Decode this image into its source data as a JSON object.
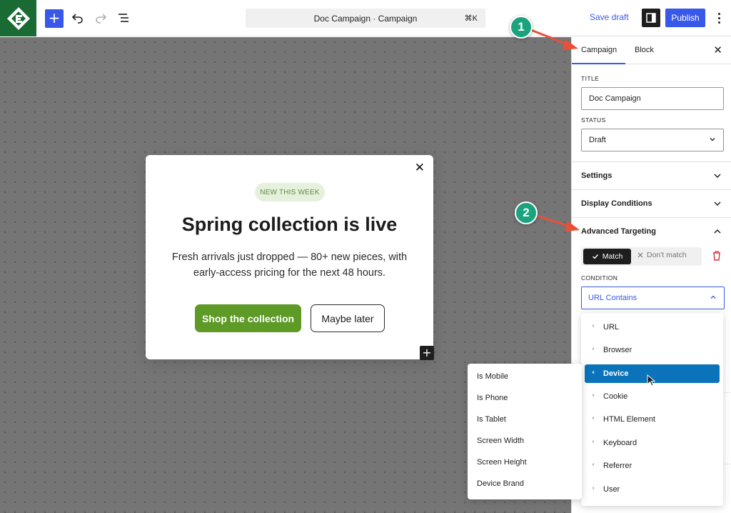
{
  "topbar": {
    "add_label": "+",
    "command_title": "Doc Campaign · Campaign",
    "command_shortcut": "⌘K",
    "save_draft_label": "Save draft",
    "publish_label": "Publish"
  },
  "popup": {
    "badge": "NEW THIS WEEK",
    "title": "Spring collection is live",
    "body": "Fresh arrivals just dropped — 80+ new pieces, with early-access pricing for the next 48 hours.",
    "primary_button": "Shop the collection",
    "secondary_button": "Maybe later",
    "close_label": "✕",
    "add_block_label": "+",
    "colors": {
      "primary": "#5d9a26",
      "badge_bg": "#e5f1dd"
    }
  },
  "sidebar": {
    "tabs": [
      "Campaign",
      "Block"
    ],
    "active_tab": "Campaign",
    "close_label": "✕",
    "title_label": "TITLE",
    "title_value": "Doc Campaign",
    "status_label": "STATUS",
    "status_value": "Draft",
    "panels": [
      "Settings",
      "Display Conditions",
      "Advanced Targeting"
    ],
    "match_label": "Match",
    "dont_match_label": "Don't match",
    "condition_label": "CONDITION",
    "condition_value": "URL Contains"
  },
  "dropdown": {
    "items": [
      "URL",
      "Browser",
      "Device",
      "Cookie",
      "HTML Element",
      "Keyboard",
      "Referrer",
      "User"
    ],
    "active": "Device"
  },
  "submenu": {
    "items": [
      "Is Mobile",
      "Is Phone",
      "Is Tablet",
      "Screen Width",
      "Screen Height",
      "Device Brand"
    ]
  },
  "callouts": [
    "1",
    "2"
  ],
  "colors": {
    "accent": "#3858e9",
    "logo_bg": "#1a6b33",
    "callout": "#1ba37e",
    "arrow": "#e8503a",
    "menu_active": "#0a73b9"
  }
}
